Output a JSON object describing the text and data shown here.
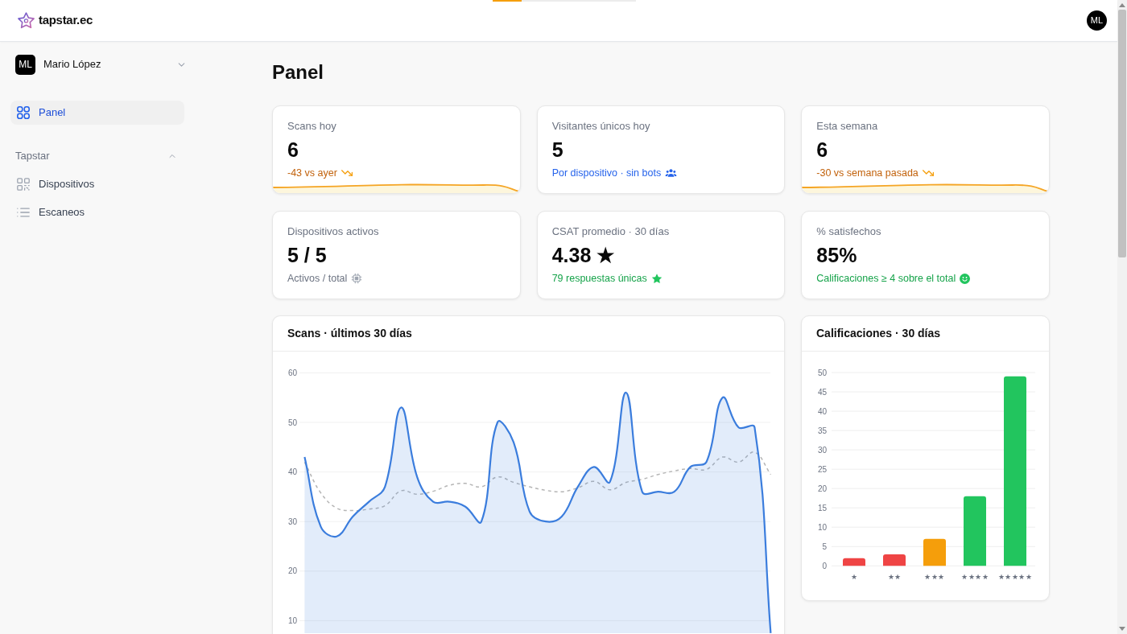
{
  "header": {
    "brand": "tapstar.ec",
    "avatar_initials": "ML",
    "progress": {
      "level": 0.2
    }
  },
  "sidebar": {
    "user": {
      "initials": "ML",
      "name": "Mario López",
      "expanded": false
    },
    "items": [
      {
        "label": "Panel",
        "selected": true
      }
    ],
    "sections": [
      {
        "title": "Tapstar",
        "expanded": true,
        "items": [
          {
            "label": "Dispositivos",
            "selected": false
          },
          {
            "label": "Escaneos",
            "selected": false
          }
        ]
      }
    ]
  },
  "page_title": "Panel",
  "stat_cards": [
    {
      "label": "Scans hoy",
      "value": "6",
      "note": "-43 vs ayer",
      "kind": "trend",
      "sparkline": true
    },
    {
      "label": "Visitantes únicos hoy",
      "value": "5",
      "note": "Por dispositivo · sin bots",
      "kind": "visitors",
      "sparkline": false
    },
    {
      "label": "Esta semana",
      "value": "6",
      "note": "-30 vs semana pasada",
      "kind": "trend",
      "sparkline": true
    },
    {
      "label": "Dispositivos activos",
      "value": "5 / 5",
      "note": "Activos / total",
      "kind": "devices",
      "sparkline": false
    },
    {
      "label": "CSAT promedio · 30 días",
      "value": "4.38 ★",
      "note": "79 respuestas únicas",
      "kind": "rating",
      "sparkline": false
    },
    {
      "label": "% satisfechos",
      "value": "85%",
      "note": "Calificaciones ≥ 4 sobre el total",
      "kind": "satisfaction",
      "sparkline": false
    }
  ],
  "scans_chart": {
    "title": "Scans · últimos 30 días",
    "chart_data": {
      "type": "area",
      "grid": true,
      "ylim": [
        0,
        60
      ],
      "yticks": [
        10,
        20,
        30,
        40,
        50,
        60
      ],
      "series": [
        {
          "type": "area",
          "color": "#3b7ddd",
          "values": [
            43,
            29,
            27,
            31,
            34,
            37,
            53,
            39,
            34,
            34,
            33,
            30,
            50,
            46,
            32,
            30,
            31,
            37,
            41,
            38,
            56,
            36,
            36,
            36,
            41,
            42,
            55,
            49,
            49,
            7.5
          ]
        },
        {
          "type": "line",
          "line_style": "dashed",
          "color": "#b5b5b5",
          "values": [
            42,
            35.8,
            32.7,
            32.2,
            32.5,
            33.2,
            36.2,
            35.5,
            36.1,
            37.3,
            37.7,
            37,
            39,
            37.9,
            37,
            36.3,
            36,
            36.8,
            38.1,
            36.4,
            37.9,
            38.5,
            39.5,
            40.2,
            40.7,
            40.5,
            43,
            42,
            44,
            39.5
          ]
        }
      ]
    }
  },
  "ratings_chart": {
    "title": "Calificaciones · 30 días",
    "chart_data": {
      "type": "bar",
      "grid": true,
      "categories": [
        "★",
        "★★",
        "★★★",
        "★★★★",
        "★★★★★"
      ],
      "values": [
        2,
        3,
        7,
        18,
        49
      ],
      "colors": [
        "#ef4444",
        "#ef4444",
        "#f59e0b",
        "#22c55e",
        "#22c55e"
      ],
      "ylim": [
        0,
        50
      ],
      "yticks": [
        0,
        5,
        10,
        15,
        20,
        25,
        30,
        35,
        40,
        45,
        50
      ]
    }
  }
}
